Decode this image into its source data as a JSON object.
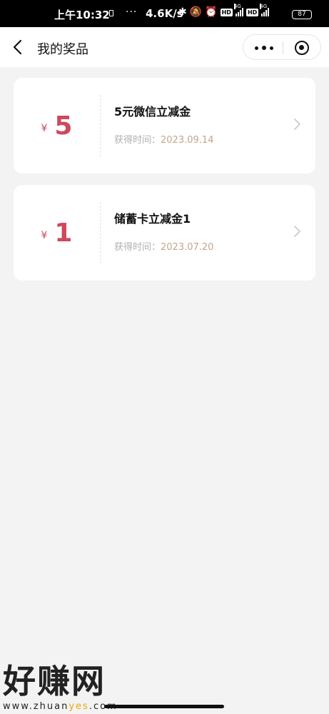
{
  "status_bar": {
    "time": "上午10:32",
    "dots": "···",
    "speed": "4.6K/s",
    "network_1": "4G",
    "network_2": "4G",
    "hd_1": "HD",
    "hd_2": "HD",
    "battery": "87"
  },
  "nav": {
    "title": "我的奖品",
    "back_icon": "chevron-left-icon",
    "more_icon": "more-dots-icon",
    "close_icon": "target-circle-icon"
  },
  "prizes": [
    {
      "currency": "¥",
      "amount": "5",
      "title": "5元微信立减金",
      "date_label": "获得时间：",
      "date": "2023.09.14"
    },
    {
      "currency": "¥",
      "amount": "1",
      "title": "储蓄卡立减金1",
      "date_label": "获得时间：",
      "date": "2023.07.20"
    }
  ],
  "watermark": {
    "logo": "好赚网",
    "url_prefix": "www.zhuan",
    "url_highlight": "yes",
    "url_suffix": ".com"
  },
  "colors": {
    "accent_red": "#cc4a5c",
    "date_tan": "#c3a58a",
    "background": "#f3f3f3"
  }
}
